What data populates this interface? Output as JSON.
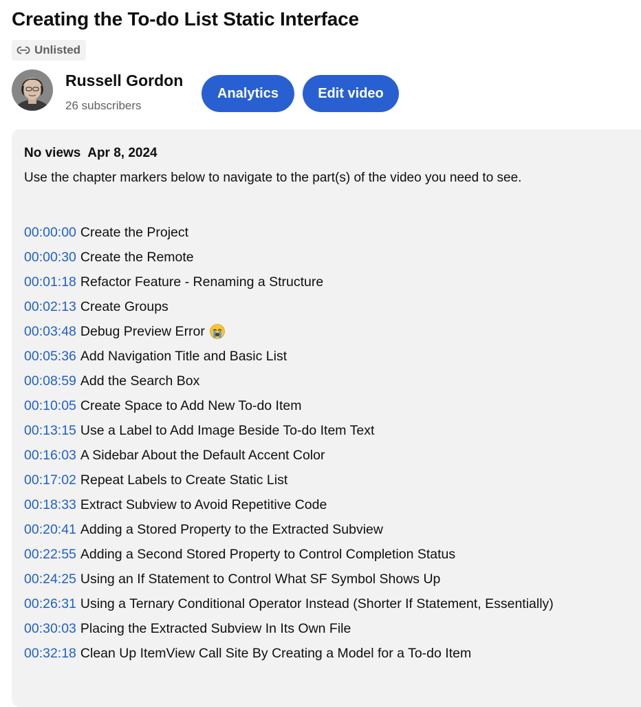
{
  "video": {
    "title": "Creating the To-do List Static Interface",
    "visibility": "Unlisted",
    "visibility_icon": "link-icon"
  },
  "channel": {
    "name": "Russell Gordon",
    "subscribers": "26 subscribers"
  },
  "actions": {
    "analytics_label": "Analytics",
    "edit_label": "Edit video",
    "accent_color": "#2860d2"
  },
  "description": {
    "meta": "No views  Apr 8, 2024",
    "intro": "Use the chapter markers below to navigate to the part(s) of the video you need to see.",
    "chapters": [
      {
        "time": "00:00:00",
        "title": "Create the Project"
      },
      {
        "time": "00:00:30",
        "title": "Create the Remote"
      },
      {
        "time": "00:01:18",
        "title": "Refactor Feature - Renaming a Structure"
      },
      {
        "time": "00:02:13",
        "title": "Create Groups"
      },
      {
        "time": "00:03:48",
        "title": "Debug Preview Error",
        "emoji": "crying-face-emoji"
      },
      {
        "time": "00:05:36",
        "title": "Add Navigation Title and Basic List"
      },
      {
        "time": "00:08:59",
        "title": "Add the Search Box"
      },
      {
        "time": "00:10:05",
        "title": "Create Space to Add New To-do Item"
      },
      {
        "time": "00:13:15",
        "title": "Use a Label to Add Image Beside To-do Item Text"
      },
      {
        "time": "00:16:03",
        "title": "A Sidebar About the Default Accent Color"
      },
      {
        "time": "00:17:02",
        "title": "Repeat Labels to Create Static List"
      },
      {
        "time": "00:18:33",
        "title": "Extract Subview to Avoid Repetitive Code"
      },
      {
        "time": "00:20:41",
        "title": "Adding a Stored Property to the Extracted Subview"
      },
      {
        "time": "00:22:55",
        "title": "Adding a Second Stored Property to Control Completion Status"
      },
      {
        "time": "00:24:25",
        "title": "Using an If Statement to Control What SF Symbol Shows Up"
      },
      {
        "time": "00:26:31",
        "title": "Using a Ternary Conditional Operator Instead (Shorter If Statement, Essentially)"
      },
      {
        "time": "00:30:03",
        "title": "Placing the Extracted Subview In Its Own File"
      },
      {
        "time": "00:32:18",
        "title": "Clean Up ItemView Call Site By Creating a Model for a To-do Item"
      }
    ],
    "timestamp_color": "#2060cc"
  }
}
